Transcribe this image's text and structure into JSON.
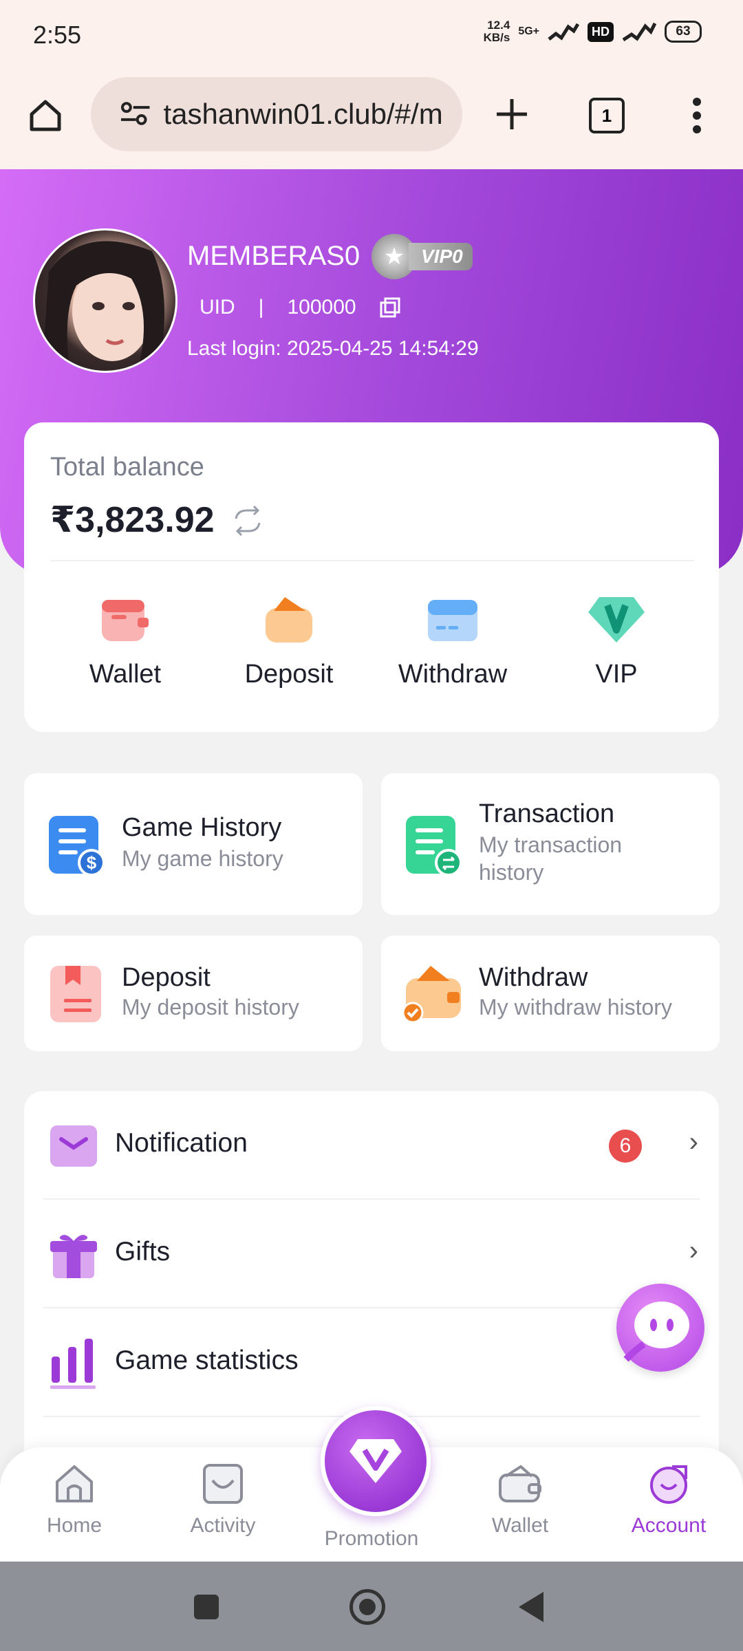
{
  "status_bar": {
    "time": "2:55",
    "speed_value": "12.4",
    "speed_unit": "KB/s",
    "network": "5G+",
    "hd": "HD",
    "battery": "63"
  },
  "browser": {
    "url": "tashanwin01.club/#/m",
    "tab_count": "1",
    "icons": [
      "home-icon",
      "site-settings-icon",
      "plus-icon",
      "tabs-icon",
      "more-icon"
    ]
  },
  "profile": {
    "username": "MEMBERAS0",
    "vip_level": "VIP0",
    "uid_label": "UID",
    "uid_separator": "|",
    "uid_value": "100000",
    "last_login": "Last login: 2025-04-25 14:54:29"
  },
  "balance": {
    "label": "Total balance",
    "amount": "₹3,823.92",
    "actions": [
      {
        "label": "Wallet",
        "icon": "wallet-icon"
      },
      {
        "label": "Deposit",
        "icon": "deposit-icon"
      },
      {
        "label": "Withdraw",
        "icon": "withdraw-icon"
      },
      {
        "label": "VIP",
        "icon": "vip-icon"
      }
    ]
  },
  "history_cards": [
    {
      "title": "Game History",
      "subtitle": "My game history",
      "icon": "game-history-icon"
    },
    {
      "title": "Transaction",
      "subtitle": "My transaction history",
      "icon": "transaction-icon"
    },
    {
      "title": "Deposit",
      "subtitle": "My deposit history",
      "icon": "deposit-history-icon"
    },
    {
      "title": "Withdraw",
      "subtitle": "My withdraw history",
      "icon": "withdraw-history-icon"
    }
  ],
  "menu": [
    {
      "label": "Notification",
      "badge": "6",
      "icon": "mail-icon"
    },
    {
      "label": "Gifts",
      "icon": "gift-icon"
    },
    {
      "label": "Game statistics",
      "icon": "bar-chart-icon"
    }
  ],
  "bottom_nav": [
    {
      "label": "Home",
      "icon": "home-icon"
    },
    {
      "label": "Activity",
      "icon": "activity-icon"
    },
    {
      "label": "Promotion",
      "icon": "diamond-icon"
    },
    {
      "label": "Wallet",
      "icon": "wallet-icon"
    },
    {
      "label": "Account",
      "icon": "account-icon",
      "active": true
    }
  ],
  "colors": {
    "brand_purple": "#9b3ad6",
    "accent_gradient_start": "#d46cf6",
    "badge_red": "#e94e4e"
  }
}
